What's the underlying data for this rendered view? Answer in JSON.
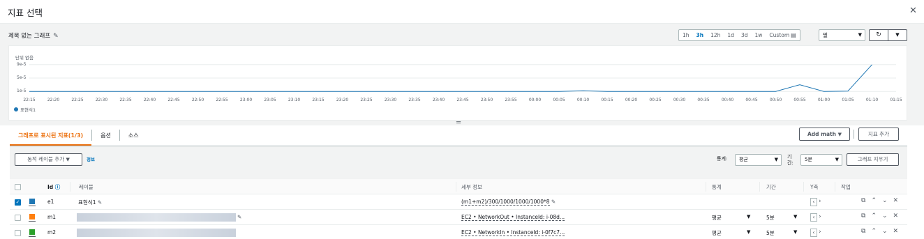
{
  "modal": {
    "title": "지표 선택",
    "close_glyph": "✕"
  },
  "graph": {
    "title": "제목 없는 그래프",
    "time_ranges": [
      "1h",
      "3h",
      "12h",
      "1d",
      "3d",
      "1w",
      "Custom"
    ],
    "active_range": "3h",
    "chart_type": "필",
    "unit_label": "단위 없음"
  },
  "chart_data": {
    "type": "line",
    "ylabel": "단위 없음",
    "y_ticks": [
      "9e-5",
      "5e-5",
      "1e-5"
    ],
    "ylim": [
      0,
      0.0001
    ],
    "x": [
      "22:15",
      "22:20",
      "22:25",
      "22:30",
      "22:35",
      "22:40",
      "22:45",
      "22:50",
      "22:55",
      "23:00",
      "23:05",
      "23:10",
      "23:15",
      "23:20",
      "23:25",
      "23:30",
      "23:35",
      "23:40",
      "23:45",
      "23:50",
      "23:55",
      "00:00",
      "00:05",
      "00:10",
      "00:15",
      "00:20",
      "00:25",
      "00:30",
      "00:35",
      "00:40",
      "00:45",
      "00:50",
      "00:55",
      "01:00",
      "01:05",
      "01:10",
      "01:15"
    ],
    "series": [
      {
        "name": "표현식1",
        "color": "#1f77b4",
        "values": [
          1e-05,
          1e-05,
          1e-05,
          1e-05,
          1e-05,
          1e-05,
          1e-05,
          1e-05,
          1e-05,
          1e-05,
          1e-05,
          1e-05,
          1e-05,
          1e-05,
          1e-05,
          1e-05,
          1e-05,
          1e-05,
          1e-05,
          1e-05,
          1e-05,
          1e-05,
          1e-05,
          1.2e-05,
          1e-05,
          1e-05,
          1e-05,
          1e-05,
          1e-05,
          1e-05,
          1e-05,
          1e-05,
          3e-05,
          1e-05,
          1.1e-05,
          9e-05,
          null
        ]
      }
    ],
    "legend": "bottom-left"
  },
  "tabs": [
    {
      "label": "그래프로 표시된 지표(1/3)",
      "active": true
    },
    {
      "label": "옵션",
      "active": false
    },
    {
      "label": "소스",
      "active": false
    }
  ],
  "toolbar": {
    "add_math": "Add math",
    "add_metric": "지표 추가"
  },
  "controls": {
    "dynamic_label": "동적 레이블 추가",
    "info": "정보",
    "stat_label": "통계:",
    "stat_value": "평균",
    "period_label": "기간:",
    "period_value": "5분",
    "clear_graph": "그래프 지우기"
  },
  "table": {
    "headers": [
      "Id",
      "레이블",
      "세부 정보",
      "통계",
      "기간",
      "Y축",
      "작업"
    ],
    "rows": [
      {
        "checked": true,
        "color": "#1f77b4",
        "id": "e1",
        "label": "표현식1",
        "details": "(m1+m2)/300/1000/1000/1000*8",
        "stat": "",
        "period": ""
      },
      {
        "checked": false,
        "color": "#ff7f0e",
        "id": "m1",
        "label": "",
        "details": "EC2 • NetworkOut • InstanceId: i-08d...",
        "stat": "평균",
        "period": "5분"
      },
      {
        "checked": false,
        "color": "#2ca02c",
        "id": "m2",
        "label": "",
        "details": "EC2 • NetworkIn • InstanceId: i-0f7c7...",
        "stat": "평균",
        "period": "5분"
      }
    ]
  }
}
